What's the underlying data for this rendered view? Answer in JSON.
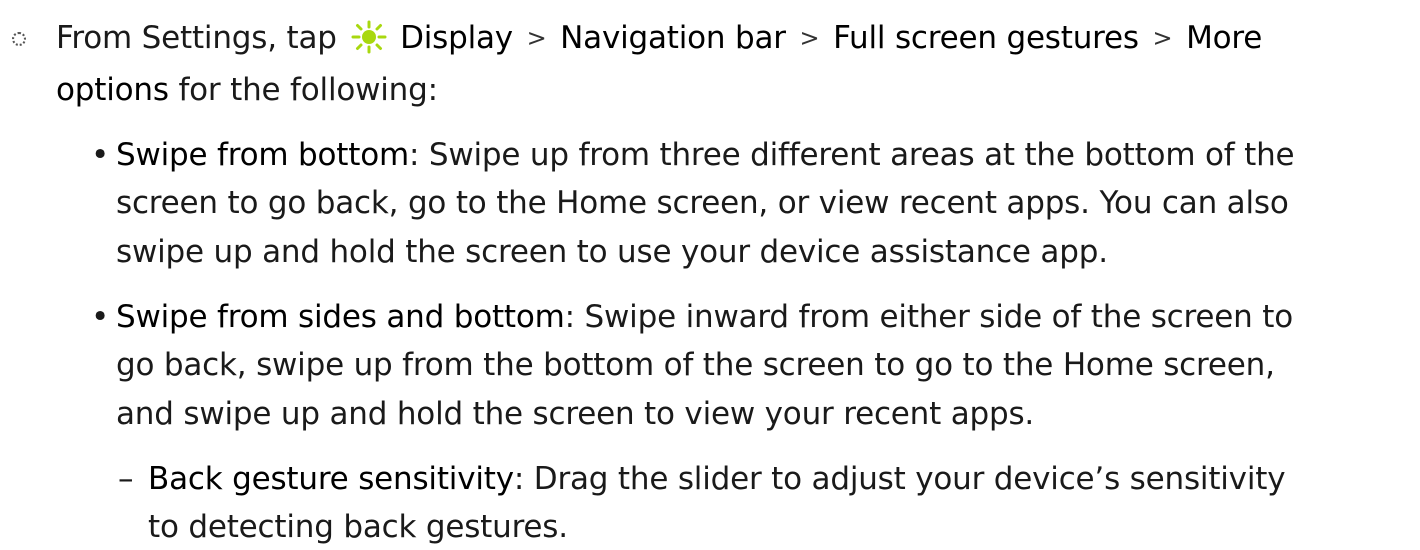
{
  "step": {
    "prefix": "From Settings, tap",
    "path": [
      "Display",
      "Navigation bar",
      "Full screen gestures",
      "More"
    ],
    "path_tail": "options",
    "suffix": "for the following:",
    "icon": "display-sun-icon",
    "accent_color": "#a8d80f"
  },
  "bullets": [
    {
      "title": "Swipe from bottom",
      "lines": [
        ": Swipe up from three different areas at the bottom of the",
        "screen to go back, go to the Home screen, or view recent apps. You can also",
        "swipe up and hold the screen to use your device assistance app."
      ]
    },
    {
      "title": "Swipe from sides and bottom",
      "lines": [
        ": Swipe inward from either side of the screen to",
        "go back, swipe up from the bottom of the screen to go to the Home screen,",
        "and swipe up and hold the screen to view your recent apps."
      ],
      "sub": {
        "title": "Back gesture sensitivity",
        "lines": [
          ": Drag the slider to adjust your device’s sensitivity",
          "to detecting back gestures."
        ]
      }
    }
  ],
  "symbols": {
    "separator": ">",
    "bullet": "•",
    "dash": "–"
  }
}
